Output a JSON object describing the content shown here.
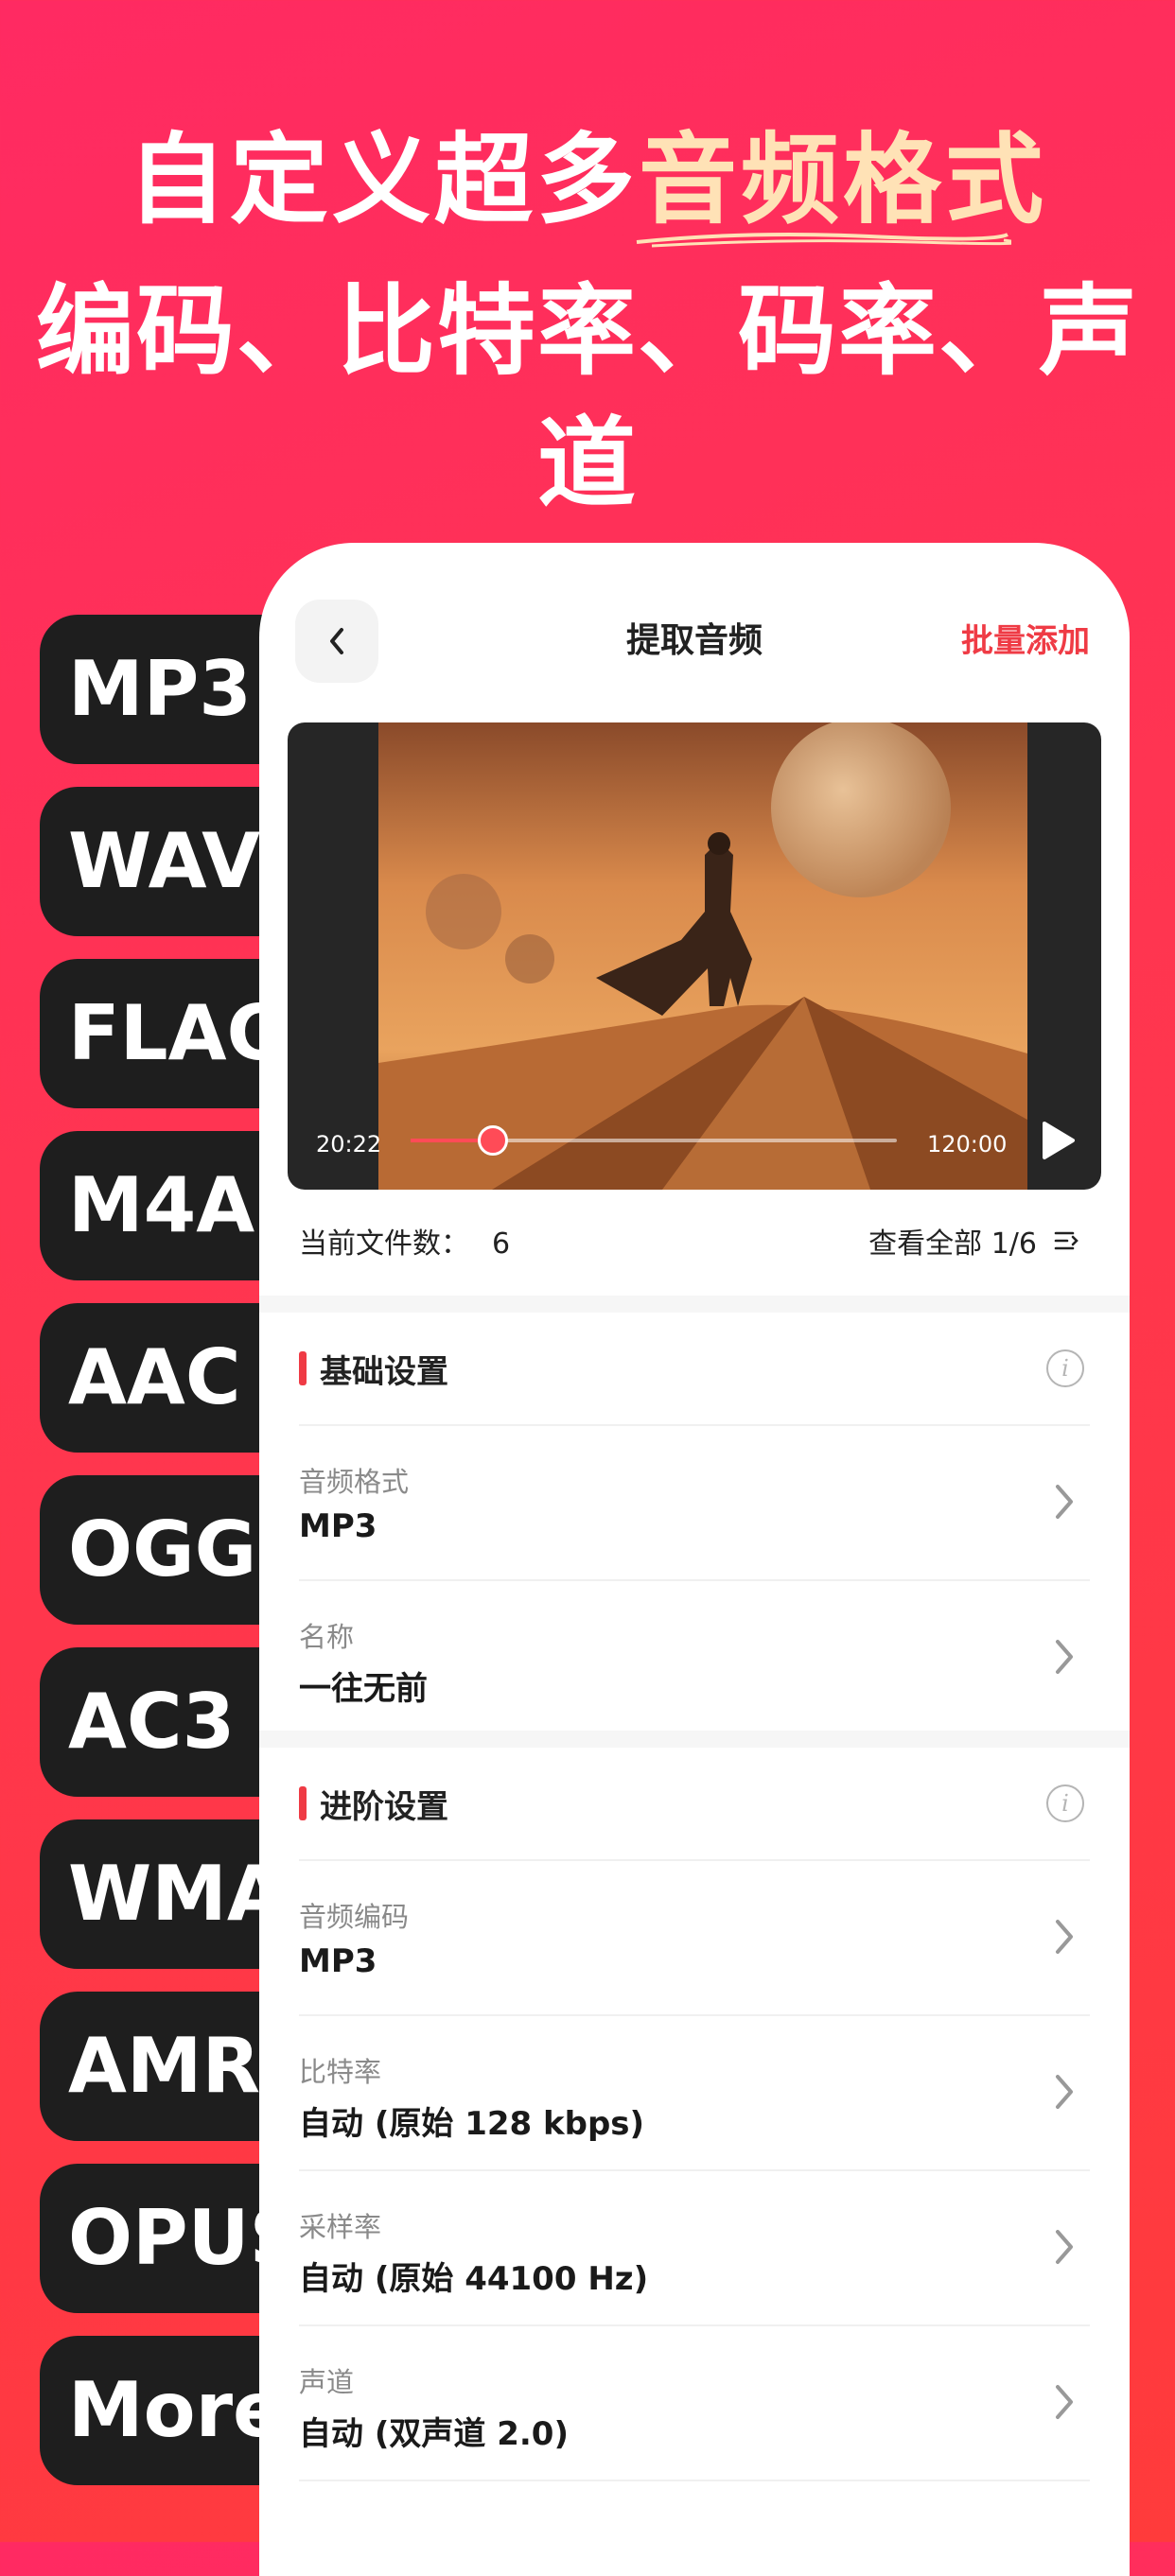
{
  "hero": {
    "line1_prefix": "自定义超多",
    "line1_highlight": "音频格式",
    "line2": "编码、比特率、码率、声道"
  },
  "formats": [
    "MP3",
    "WAV",
    "FLAC",
    "M4A",
    "AAC",
    "OGG",
    "AC3",
    "WMA",
    "AMR",
    "OPUS",
    "More"
  ],
  "app": {
    "title": "提取音频",
    "batch_add": "批量添加",
    "player": {
      "current_time": "20:22",
      "total_time": "120:00",
      "progress": 0.17
    },
    "file_count_label": "当前文件数：",
    "file_count": "6",
    "view_all": "查看全部 1/6",
    "basic": {
      "title": "基础设置",
      "rows": [
        {
          "label": "音频格式",
          "value": "MP3"
        },
        {
          "label": "名称",
          "value": "一往无前"
        }
      ]
    },
    "advanced": {
      "title": "进阶设置",
      "rows": [
        {
          "label": "音频编码",
          "value": "MP3"
        },
        {
          "label": "比特率",
          "value": "自动 (原始 128 kbps)"
        },
        {
          "label": "采样率",
          "value": "自动 (原始 44100 Hz)"
        },
        {
          "label": "声道",
          "value": "自动 (双声道 2.0)"
        }
      ]
    }
  },
  "colors": {
    "accent": "#ef3b45",
    "highlight": "#ffe2b6",
    "pill": "#1e1e1e"
  }
}
